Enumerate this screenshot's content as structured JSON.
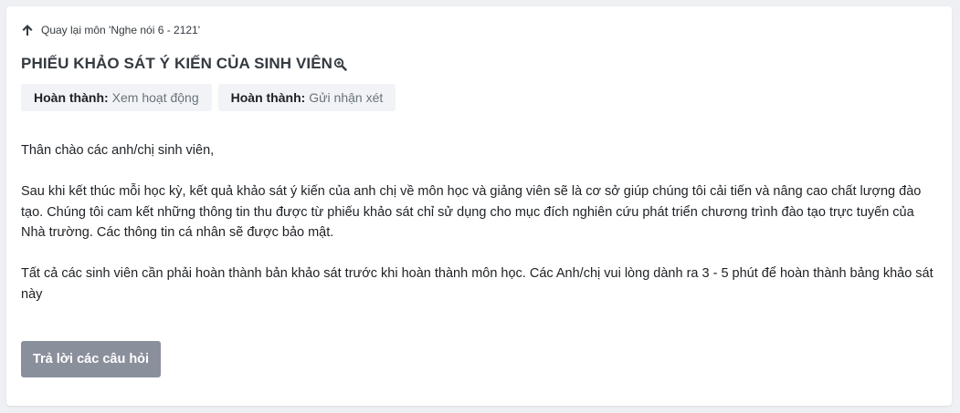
{
  "back_link": {
    "label": "Quay lại môn 'Nghe nói 6 - 2121'",
    "icon": "arrow-up-icon"
  },
  "page_title": "PHIẾU KHẢO SÁT Ý KIẾN CỦA SINH VIÊN",
  "title_icon": "zoom-search-icon",
  "completion_badges": [
    {
      "label": "Hoàn thành:",
      "value": "Xem hoạt động"
    },
    {
      "label": "Hoàn thành:",
      "value": "Gửi nhận xét"
    }
  ],
  "paragraphs": [
    "Thân chào các anh/chị sinh viên,",
    "Sau khi kết thúc mỗi học kỳ, kết quả khảo sát ý kiến của anh chị về môn học và giảng viên sẽ là cơ sở giúp chúng tôi cải tiến và nâng cao chất lượng đào tạo. Chúng tôi cam kết những thông tin thu được từ phiếu khảo sát chỉ sử dụng cho mục đích nghiên cứu phát triển chương trình đào tạo trực tuyến của Nhà trường. Các thông tin cá nhân sẽ được bảo mật.",
    "Tất cả các sinh viên cần phải hoàn thành bản khảo sát trước khi hoàn thành môn học. Các Anh/chị vui lòng dành ra 3 - 5 phút để hoàn thành bảng khảo sát này"
  ],
  "action_button": "Trả lời các câu hỏi",
  "colors": {
    "page_background": "#eef0f3",
    "card_background": "#ffffff",
    "badge_background": "#f1f3f6",
    "button_background": "#8a8f9c",
    "button_text": "#ffffff"
  }
}
